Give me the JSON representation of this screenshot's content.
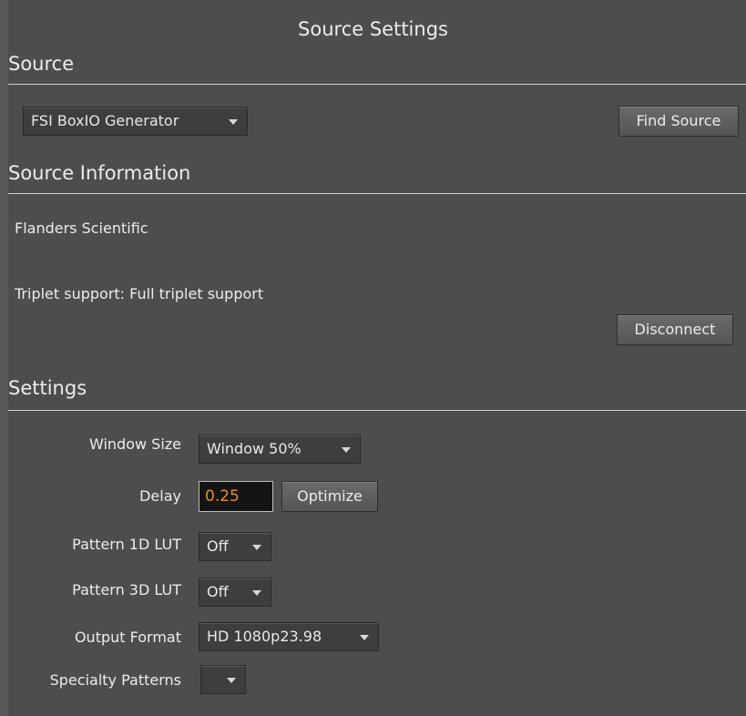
{
  "title": "Source Settings",
  "source": {
    "heading": "Source",
    "selected": "FSI BoxIO Generator",
    "find_button": "Find Source"
  },
  "source_info": {
    "heading": "Source Information",
    "manufacturer": "Flanders Scientific",
    "triplet": "Triplet support: Full triplet support",
    "disconnect_button": "Disconnect"
  },
  "settings": {
    "heading": "Settings",
    "window_size": {
      "label": "Window Size",
      "value": "Window 50%"
    },
    "delay": {
      "label": "Delay",
      "value": "0.25",
      "optimize_button": "Optimize"
    },
    "pattern_1d_lut": {
      "label": "Pattern 1D LUT",
      "value": "Off"
    },
    "pattern_3d_lut": {
      "label": "Pattern 3D LUT",
      "value": "Off"
    },
    "output_format": {
      "label": "Output Format",
      "value": "HD 1080p23.98"
    },
    "specialty_patterns": {
      "label": "Specialty Patterns",
      "value": ""
    }
  },
  "colors": {
    "panel": "#4d4d4d",
    "delay_text": "#e0902a"
  }
}
